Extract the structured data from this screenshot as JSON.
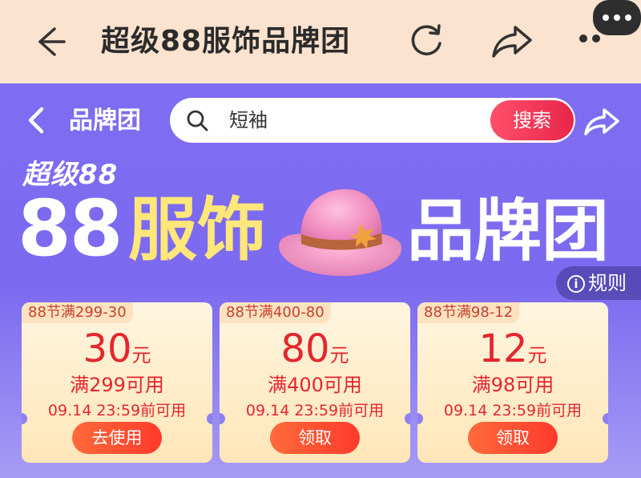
{
  "topbar": {
    "title": "超级88服饰品牌团"
  },
  "header": {
    "title": "品牌团",
    "search_value": "短袖",
    "search_button": "搜索",
    "brand_small": "超级88",
    "hero_88": "88",
    "hero_main": "服饰",
    "hero_right": "品牌团",
    "rules_label": "规则",
    "rules_icon_glyph": "i"
  },
  "coupons": [
    {
      "tag": "88节满299-30",
      "amount": "30",
      "unit": "元",
      "condition": "满299可用",
      "expiry": "09.14 23:59前可用",
      "button": "去使用"
    },
    {
      "tag": "88节满400-80",
      "amount": "80",
      "unit": "元",
      "condition": "满400可用",
      "expiry": "09.14 23:59前可用",
      "button": "领取"
    },
    {
      "tag": "88节满98-12",
      "amount": "12",
      "unit": "元",
      "condition": "满98可用",
      "expiry": "09.14 23:59前可用",
      "button": "领取"
    }
  ],
  "icons": {
    "back": "back-arrow-icon",
    "refresh": "refresh-icon",
    "share": "share-icon",
    "more": "more-dots-icon",
    "search": "search-icon"
  },
  "colors": {
    "accent": "#e4262f",
    "header_bg": "#7d6cf0",
    "hero_yellow": "#ffe77a",
    "topbar_bg": "#fbe3cf"
  }
}
